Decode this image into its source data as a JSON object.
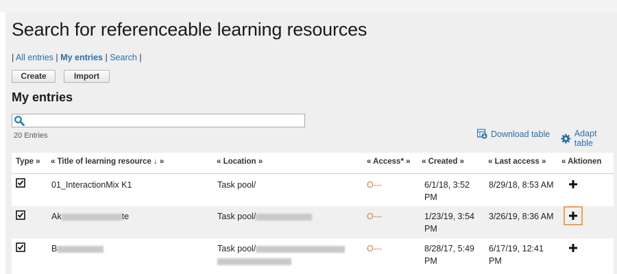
{
  "header": {
    "title": "Search for referenceable learning resources"
  },
  "nav": {
    "all_entries": "All entries",
    "my_entries": "My entries",
    "search": "Search",
    "sep": "|"
  },
  "buttons": {
    "create": "Create",
    "import": "Import"
  },
  "section": {
    "title": "My entries"
  },
  "search": {
    "value": "",
    "placeholder": ""
  },
  "list": {
    "count": "20 Entries"
  },
  "tools": {
    "download": "Download table",
    "adapt": "Adapt table"
  },
  "table": {
    "headers": {
      "type": "Type »",
      "title": "«  Title of learning resource ↓ »",
      "location": "«  Location »",
      "access": "«  Access* »",
      "created": "«  Created »",
      "last_access": "«  Last access »",
      "actions": "«  Aktionen"
    },
    "rows": [
      {
        "title": "01_InteractionMix K1",
        "location": "Task pool/",
        "access": "O---",
        "created_1": "6/1/18, 3:52",
        "created_2": "PM",
        "last_access": "8/29/18, 8:53 AM"
      },
      {
        "title_prefix": "Ak",
        "title_suffix": "te",
        "location": "Task pool/",
        "access": "O---",
        "created_1": "1/23/19, 3:54",
        "created_2": "PM",
        "last_access": "3/26/19, 8:36 AM"
      },
      {
        "title_prefix": "B",
        "location": "Task pool/",
        "access": "O---",
        "created_1": "8/28/17, 5:49",
        "created_2": "PM",
        "last_access_1": "6/17/19, 12:41",
        "last_access_2": "PM"
      }
    ]
  },
  "icons": {
    "search": "magnifier-icon",
    "download": "download-table-icon",
    "adapt": "gear-icon",
    "checkbox": "checkbox-icon",
    "add": "plus-icon"
  },
  "colors": {
    "link": "#2a6ea7",
    "access": "#e07a2e",
    "focus": "#f0a04b",
    "search_icon": "#1f7fb5"
  }
}
